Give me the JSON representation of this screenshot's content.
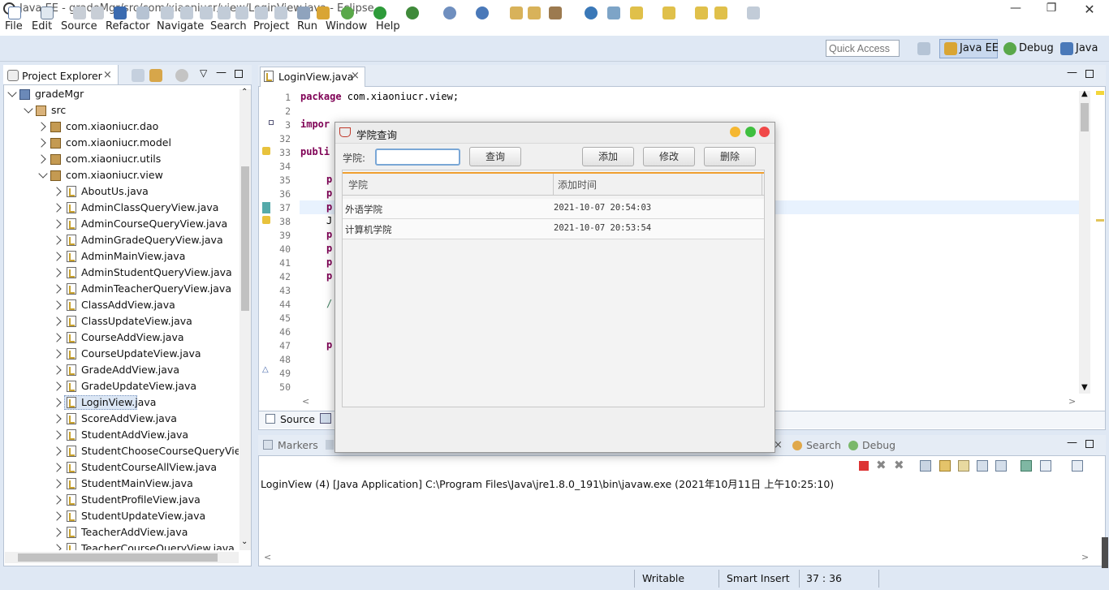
{
  "window": {
    "title": "Java EE - gradeMgr/src/com/xiaoniucr/view/LoginView.java - Eclipse"
  },
  "menu": [
    "File",
    "Edit",
    "Source",
    "Refactor",
    "Navigate",
    "Search",
    "Project",
    "Run",
    "Window",
    "Help"
  ],
  "quick_access": {
    "placeholder": "Quick Access"
  },
  "perspectives": [
    "Java EE",
    "Debug",
    "Java"
  ],
  "project_explorer": {
    "title": "Project Explorer",
    "project": "gradeMgr",
    "src": "src",
    "packages": [
      "com.xiaoniucr.dao",
      "com.xiaoniucr.model",
      "com.xiaoniucr.utils",
      "com.xiaoniucr.view"
    ],
    "files": [
      "AboutUs.java",
      "AdminClassQueryView.java",
      "AdminCourseQueryView.java",
      "AdminGradeQueryView.java",
      "AdminMainView.java",
      "AdminStudentQueryView.java",
      "AdminTeacherQueryView.java",
      "ClassAddView.java",
      "ClassUpdateView.java",
      "CourseAddView.java",
      "CourseUpdateView.java",
      "GradeAddView.java",
      "GradeUpdateView.java",
      "LoginView.java",
      "ScoreAddView.java",
      "StudentAddView.java",
      "StudentChooseCourseQueryView",
      "StudentCourseAllView.java",
      "StudentMainView.java",
      "StudentProfileView.java",
      "StudentUpdateView.java",
      "TeacherAddView.java",
      "TeacherCourseQueryView.java"
    ]
  },
  "editor": {
    "tab": "LoginView.java",
    "line_numbers": [
      "1",
      "2",
      "3",
      "32",
      "33",
      "34",
      "35",
      "36",
      "37",
      "38",
      "39",
      "40",
      "41",
      "42",
      "43",
      "44",
      "45",
      "46",
      "47",
      "48",
      "49",
      "50"
    ],
    "code": {
      "l1_kw": "package",
      "l1_rest": " com.xiaoniucr.view;",
      "l3": "impor",
      "l33": "publi",
      "l35": "p",
      "l36": "p",
      "l37": "p",
      "l38": "J",
      "l39": "p",
      "l40": "p",
      "l41": "p",
      "l42": "p",
      "l44": "/",
      "l47": "p"
    },
    "source_tab": "Source"
  },
  "bottom": {
    "tabs": [
      "Markers",
      "Search",
      "Debug"
    ],
    "console": "LoginView (4) [Java Application] C:\\Program Files\\Java\\jre1.8.0_191\\bin\\javaw.exe (2021年10月11日 上午10:25:10)"
  },
  "status": {
    "writable": "Writable",
    "insert": "Smart Insert",
    "position": "37 : 36"
  },
  "dialog": {
    "title": "学院查询",
    "label": "学院:",
    "input_value": "",
    "buttons": {
      "query": "查询",
      "add": "添加",
      "edit": "修改",
      "delete": "删除"
    },
    "columns": [
      "学院",
      "添加时间"
    ],
    "rows": [
      {
        "name": "外语学院",
        "time": "2021-10-07 20:54:03"
      },
      {
        "name": "计算机学院",
        "time": "2021-10-07 20:53:54"
      }
    ],
    "dots": [
      "#f5b731",
      "#3fbf3f",
      "#f04848"
    ]
  }
}
